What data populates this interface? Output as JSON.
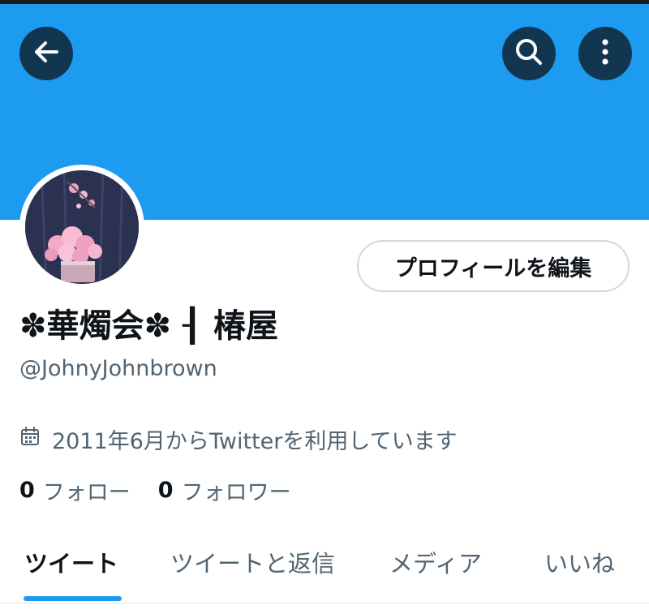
{
  "header": {
    "back_icon": "arrow-left-icon",
    "search_icon": "search-icon",
    "more_icon": "more-vertical-icon",
    "banner_color": "#1d9bf0"
  },
  "profile": {
    "edit_button_label": "プロフィールを編集",
    "display_name": "✽華燭会✽ ┨ 椿屋",
    "handle": "@JohnyJohnbrown",
    "joined_icon": "calendar-icon",
    "joined_text": "2011年6月からTwitterを利用しています",
    "following_count": "0",
    "following_label": "フォロー",
    "followers_count": "0",
    "followers_label": "フォロワー"
  },
  "tabs": [
    {
      "label": "ツイート",
      "active": true
    },
    {
      "label": "ツイートと返信",
      "active": false
    },
    {
      "label": "メディア",
      "active": false
    },
    {
      "label": "いいね",
      "active": false
    }
  ],
  "colors": {
    "accent": "#1d9bf0",
    "text_primary": "#0f1419",
    "text_secondary": "#536471"
  }
}
